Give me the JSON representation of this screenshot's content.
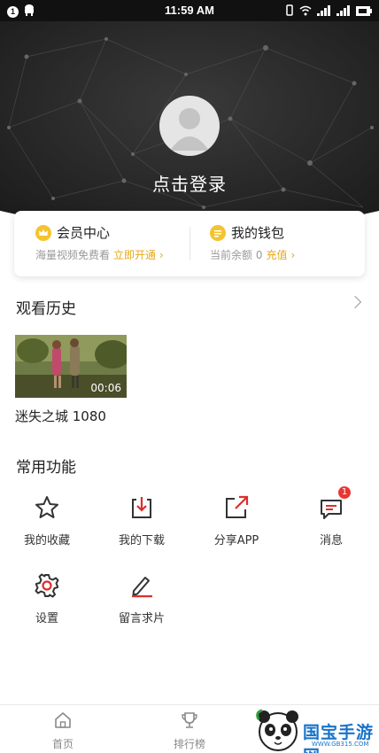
{
  "status_bar": {
    "time": "11:59 AM",
    "notification_count": "1",
    "icons": [
      "android-icon",
      "vibrate-icon",
      "wifi-icon",
      "signal-icon",
      "signal-icon",
      "battery-icon"
    ]
  },
  "profile": {
    "login_label": "点击登录"
  },
  "member_card": {
    "vip": {
      "title": "会员中心",
      "subtitle": "海量视频免费看",
      "action": "立即开通"
    },
    "wallet": {
      "title": "我的钱包",
      "subtitle": "当前余额 0",
      "action": "充值"
    }
  },
  "history": {
    "title": "观看历史",
    "items": [
      {
        "title": "迷失之城 1080",
        "duration": "00:06"
      }
    ]
  },
  "functions": {
    "title": "常用功能",
    "items": [
      {
        "label": "我的收藏",
        "icon": "star-icon"
      },
      {
        "label": "我的下载",
        "icon": "download-icon"
      },
      {
        "label": "分享APP",
        "icon": "share-icon"
      },
      {
        "label": "消息",
        "icon": "message-icon",
        "badge": "1"
      },
      {
        "label": "设置",
        "icon": "gear-icon"
      },
      {
        "label": "留言求片",
        "icon": "edit-icon"
      }
    ]
  },
  "tab_bar": {
    "tabs": [
      {
        "label": "首页",
        "icon": "home-icon"
      },
      {
        "label": "排行榜",
        "icon": "trophy-icon"
      }
    ]
  },
  "watermark": {
    "text": "国宝手游网",
    "url": "WWW.GB315.COM"
  },
  "colors": {
    "accent": "#e6a817",
    "icon_red": "#d9302c",
    "badge": "#e53935",
    "hero_bg": "#2b2b2b"
  }
}
